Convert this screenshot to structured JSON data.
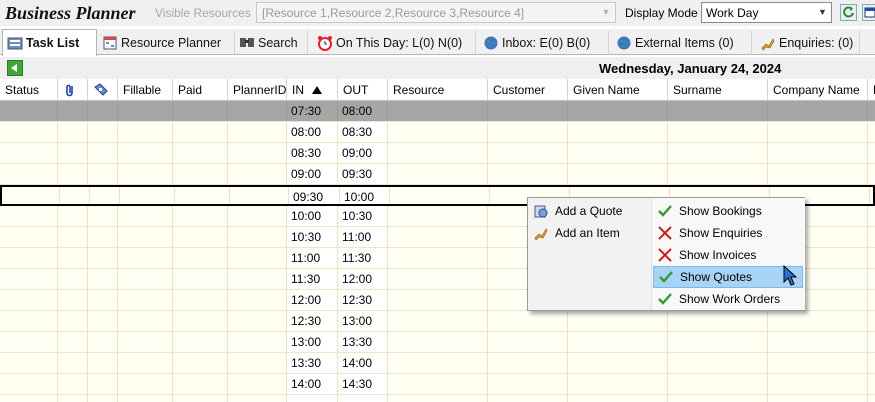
{
  "app": {
    "title": "Business Planner",
    "visible_resources_label": "Visible Resources",
    "visible_resources_value": "[Resource 1,Resource 2,Resource 3,Resource 4]",
    "display_mode_label": "Display Mode",
    "display_mode_value": "Work Day"
  },
  "tabs": [
    {
      "label": "Task List",
      "icon": "task-list-icon"
    },
    {
      "label": "Resource Planner",
      "icon": "resource-planner-icon"
    },
    {
      "label": "Search",
      "icon": "search-icon"
    },
    {
      "label": "On This Day: L(0) N(0)",
      "icon": "alarm-clock-icon"
    },
    {
      "label": "Inbox: E(0) B(0)",
      "icon": "globe-icon"
    },
    {
      "label": "External Items (0)",
      "icon": "globe-icon"
    },
    {
      "label": "Enquiries: (0)",
      "icon": "phone-icon"
    }
  ],
  "date_header": "Wednesday, January 24, 2024",
  "columns": [
    "Status",
    "",
    "",
    "Fillable",
    "Paid",
    "PlannerID",
    "IN",
    "OUT",
    "Resource",
    "Customer",
    "Given Name",
    "Surname",
    "Company Name",
    "P"
  ],
  "rows": [
    {
      "in": "07:30",
      "out": "08:00"
    },
    {
      "in": "08:00",
      "out": "08:30"
    },
    {
      "in": "08:30",
      "out": "09:00"
    },
    {
      "in": "09:00",
      "out": "09:30"
    },
    {
      "in": "09:30",
      "out": "10:00"
    },
    {
      "in": "10:00",
      "out": "10:30"
    },
    {
      "in": "10:30",
      "out": "11:00"
    },
    {
      "in": "11:00",
      "out": "11:30"
    },
    {
      "in": "11:30",
      "out": "12:00"
    },
    {
      "in": "12:00",
      "out": "12:30"
    },
    {
      "in": "12:30",
      "out": "13:00"
    },
    {
      "in": "13:00",
      "out": "13:30"
    },
    {
      "in": "13:30",
      "out": "14:00"
    },
    {
      "in": "14:00",
      "out": "14:30"
    },
    {
      "in": "",
      "out": ""
    }
  ],
  "context_menu": {
    "left_items": [
      {
        "label": "Add a Quote",
        "icon": "quote-icon"
      },
      {
        "label": "Add an Item",
        "icon": "item-icon"
      }
    ],
    "right_items": [
      {
        "label": "Show Bookings",
        "icon": "check-icon",
        "checked": true
      },
      {
        "label": "Show Enquiries",
        "icon": "cross-icon",
        "checked": false
      },
      {
        "label": "Show Invoices",
        "icon": "cross-icon",
        "checked": false
      },
      {
        "label": "Show Quotes",
        "icon": "check-icon",
        "checked": true,
        "highlighted": true
      },
      {
        "label": "Show Work Orders",
        "icon": "check-icon",
        "checked": true
      }
    ]
  },
  "colors": {
    "accent_highlight": "#a7d3f5",
    "row_bg": "#fffff4",
    "first_row_bg": "#a6a6a6",
    "check_green": "#2f9a2f",
    "cross_red": "#c81e1e"
  }
}
